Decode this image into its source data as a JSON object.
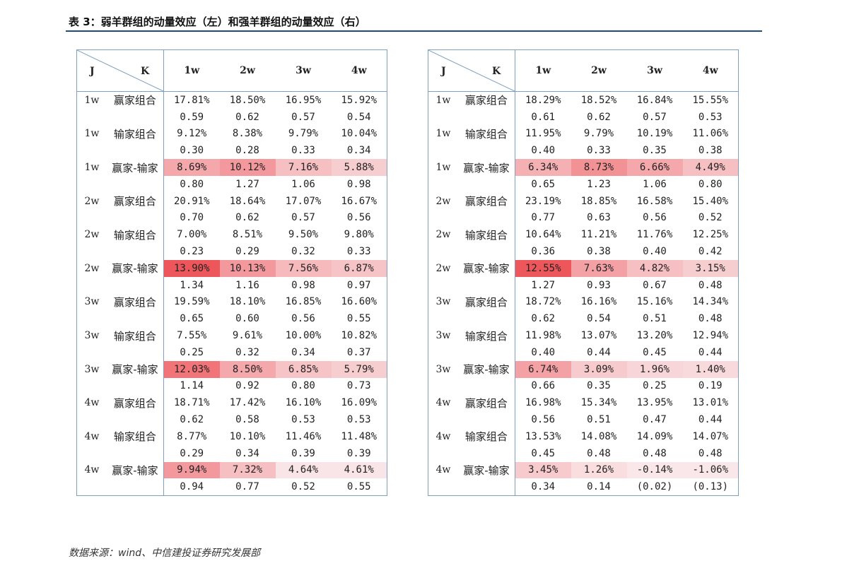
{
  "title": "表 3：弱羊群组的动量效应（左）和强羊群组的动量效应（右）",
  "source": "数据来源：wind、中信建投证券研究发展部",
  "header": {
    "j": "J",
    "k": "K",
    "cols": [
      "1w",
      "2w",
      "3w",
      "4w"
    ]
  },
  "colors": {
    "rule": "#1f4e79",
    "grid": "#7f9fc0"
  },
  "tables": [
    {
      "rows": [
        {
          "j": "1w",
          "k": "赢家组合",
          "vals": [
            "17.81%",
            "18.50%",
            "16.95%",
            "15.92%"
          ],
          "t": [
            "0.59",
            "0.62",
            "0.57",
            "0.54"
          ],
          "heat": [
            0,
            0,
            0,
            0
          ]
        },
        {
          "j": "1w",
          "k": "输家组合",
          "vals": [
            "9.12%",
            "8.38%",
            "9.79%",
            "10.04%"
          ],
          "t": [
            "0.30",
            "0.28",
            "0.33",
            "0.34"
          ],
          "heat": [
            0,
            0,
            0,
            0
          ]
        },
        {
          "j": "1w",
          "k": "赢家-输家",
          "vals": [
            "8.69%",
            "10.12%",
            "7.16%",
            "5.88%"
          ],
          "t": [
            "0.80",
            "1.27",
            "1.06",
            "0.98"
          ],
          "heat": [
            0.45,
            0.55,
            0.3,
            0.2
          ]
        },
        {
          "j": "2w",
          "k": "赢家组合",
          "vals": [
            "20.91%",
            "18.64%",
            "17.07%",
            "16.67%"
          ],
          "t": [
            "0.70",
            "0.62",
            "0.57",
            "0.56"
          ],
          "heat": [
            0,
            0,
            0,
            0
          ]
        },
        {
          "j": "2w",
          "k": "输家组合",
          "vals": [
            "7.00%",
            "8.51%",
            "9.50%",
            "9.80%"
          ],
          "t": [
            "0.23",
            "0.29",
            "0.32",
            "0.33"
          ],
          "heat": [
            0,
            0,
            0,
            0
          ]
        },
        {
          "j": "2w",
          "k": "赢家-输家",
          "vals": [
            "13.90%",
            "10.13%",
            "7.56%",
            "6.87%"
          ],
          "t": [
            "1.34",
            "1.16",
            "0.98",
            "0.97"
          ],
          "heat": [
            1.0,
            0.55,
            0.33,
            0.27
          ]
        },
        {
          "j": "3w",
          "k": "赢家组合",
          "vals": [
            "19.59%",
            "18.10%",
            "16.85%",
            "16.60%"
          ],
          "t": [
            "0.65",
            "0.60",
            "0.56",
            "0.55"
          ],
          "heat": [
            0,
            0,
            0,
            0
          ]
        },
        {
          "j": "3w",
          "k": "输家组合",
          "vals": [
            "7.55%",
            "9.61%",
            "10.00%",
            "10.82%"
          ],
          "t": [
            "0.25",
            "0.32",
            "0.34",
            "0.37"
          ],
          "heat": [
            0,
            0,
            0,
            0
          ]
        },
        {
          "j": "3w",
          "k": "赢家-输家",
          "vals": [
            "12.03%",
            "8.50%",
            "6.85%",
            "5.79%"
          ],
          "t": [
            "1.14",
            "0.92",
            "0.80",
            "0.73"
          ],
          "heat": [
            0.8,
            0.45,
            0.27,
            0.2
          ]
        },
        {
          "j": "4w",
          "k": "赢家组合",
          "vals": [
            "18.71%",
            "17.42%",
            "16.10%",
            "16.09%"
          ],
          "t": [
            "0.62",
            "0.58",
            "0.53",
            "0.53"
          ],
          "heat": [
            0,
            0,
            0,
            0
          ]
        },
        {
          "j": "4w",
          "k": "输家组合",
          "vals": [
            "8.77%",
            "10.10%",
            "11.46%",
            "11.48%"
          ],
          "t": [
            "0.29",
            "0.34",
            "0.39",
            "0.39"
          ],
          "heat": [
            0,
            0,
            0,
            0
          ]
        },
        {
          "j": "4w",
          "k": "赢家-输家",
          "vals": [
            "9.94%",
            "7.32%",
            "4.64%",
            "4.61%"
          ],
          "t": [
            "0.94",
            "0.77",
            "0.52",
            "0.55"
          ],
          "heat": [
            0.55,
            0.3,
            0.05,
            0.05
          ]
        }
      ]
    },
    {
      "rows": [
        {
          "j": "1w",
          "k": "赢家组合",
          "vals": [
            "18.29%",
            "18.52%",
            "16.84%",
            "15.55%"
          ],
          "t": [
            "0.61",
            "0.62",
            "0.57",
            "0.53"
          ],
          "heat": [
            0,
            0,
            0,
            0
          ]
        },
        {
          "j": "1w",
          "k": "输家组合",
          "vals": [
            "11.95%",
            "9.79%",
            "10.19%",
            "11.06%"
          ],
          "t": [
            "0.40",
            "0.33",
            "0.35",
            "0.38"
          ],
          "heat": [
            0,
            0,
            0,
            0
          ]
        },
        {
          "j": "1w",
          "k": "赢家-输家",
          "vals": [
            "6.34%",
            "8.73%",
            "6.66%",
            "4.49%"
          ],
          "t": [
            "0.65",
            "1.23",
            "1.06",
            "0.80"
          ],
          "heat": [
            0.4,
            0.6,
            0.45,
            0.3
          ]
        },
        {
          "j": "2w",
          "k": "赢家组合",
          "vals": [
            "23.19%",
            "18.85%",
            "16.58%",
            "15.40%"
          ],
          "t": [
            "0.77",
            "0.63",
            "0.56",
            "0.52"
          ],
          "heat": [
            0,
            0,
            0,
            0
          ]
        },
        {
          "j": "2w",
          "k": "输家组合",
          "vals": [
            "10.64%",
            "11.21%",
            "11.76%",
            "12.25%"
          ],
          "t": [
            "0.36",
            "0.38",
            "0.40",
            "0.42"
          ],
          "heat": [
            0,
            0,
            0,
            0
          ]
        },
        {
          "j": "2w",
          "k": "赢家-输家",
          "vals": [
            "12.55%",
            "7.63%",
            "4.82%",
            "3.15%"
          ],
          "t": [
            "1.27",
            "0.93",
            "0.67",
            "0.48"
          ],
          "heat": [
            1.0,
            0.5,
            0.3,
            0.2
          ]
        },
        {
          "j": "3w",
          "k": "赢家组合",
          "vals": [
            "18.72%",
            "16.16%",
            "15.16%",
            "14.34%"
          ],
          "t": [
            "0.62",
            "0.54",
            "0.51",
            "0.48"
          ],
          "heat": [
            0,
            0,
            0,
            0
          ]
        },
        {
          "j": "3w",
          "k": "输家组合",
          "vals": [
            "11.98%",
            "13.07%",
            "13.20%",
            "12.94%"
          ],
          "t": [
            "0.40",
            "0.44",
            "0.45",
            "0.44"
          ],
          "heat": [
            0,
            0,
            0,
            0
          ]
        },
        {
          "j": "3w",
          "k": "赢家-输家",
          "vals": [
            "6.74%",
            "3.09%",
            "1.96%",
            "1.40%"
          ],
          "t": [
            "0.66",
            "0.35",
            "0.25",
            "0.19"
          ],
          "heat": [
            0.5,
            0.22,
            0.15,
            0.12
          ]
        },
        {
          "j": "4w",
          "k": "赢家组合",
          "vals": [
            "16.98%",
            "15.34%",
            "13.95%",
            "13.01%"
          ],
          "t": [
            "0.56",
            "0.51",
            "0.47",
            "0.44"
          ],
          "heat": [
            0,
            0,
            0,
            0
          ]
        },
        {
          "j": "4w",
          "k": "输家组合",
          "vals": [
            "13.53%",
            "14.08%",
            "14.09%",
            "14.07%"
          ],
          "t": [
            "0.45",
            "0.48",
            "0.48",
            "0.48"
          ],
          "heat": [
            0,
            0,
            0,
            0
          ]
        },
        {
          "j": "4w",
          "k": "赢家-输家",
          "vals": [
            "3.45%",
            "1.26%",
            "-0.14%",
            "-1.06%"
          ],
          "t": [
            "0.34",
            "0.14",
            "(0.02)",
            "(0.13)"
          ],
          "heat": [
            0.22,
            0.1,
            0.03,
            0.03
          ]
        }
      ]
    }
  ]
}
